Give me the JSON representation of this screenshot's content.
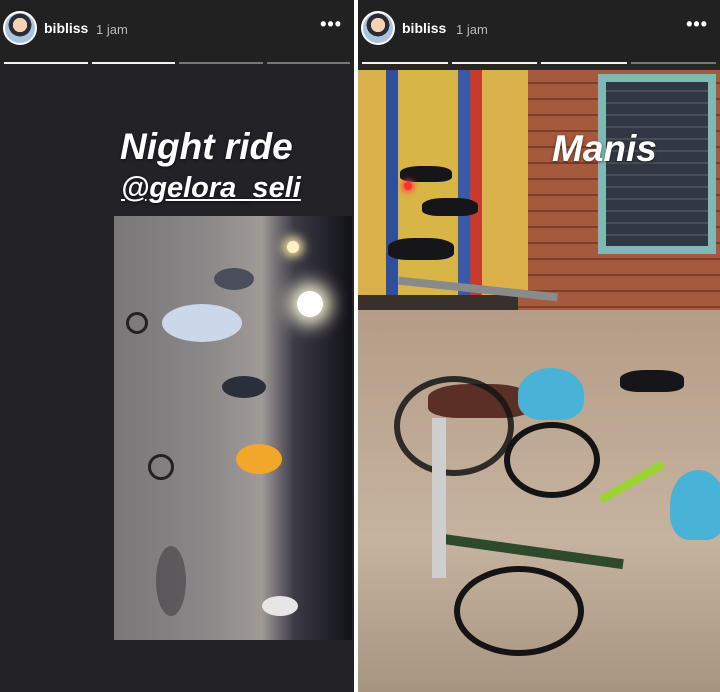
{
  "stories": [
    {
      "username": "bibliss",
      "time": "1 jam",
      "more_icon": "more-horizontal-icon",
      "progress": {
        "segments": 4,
        "current": 2
      },
      "captions": [
        "Night ride",
        "@gelora_seli"
      ]
    },
    {
      "username": "bibliss",
      "time": "1 jam",
      "more_icon": "more-horizontal-icon",
      "progress": {
        "segments": 4,
        "current": 3
      },
      "captions": [
        "Manis"
      ]
    }
  ],
  "colors": {
    "header_bg": "#212121",
    "progress_done": "#f2f2f2",
    "progress_pending": "#777777",
    "caption_text": "#ffffff"
  }
}
